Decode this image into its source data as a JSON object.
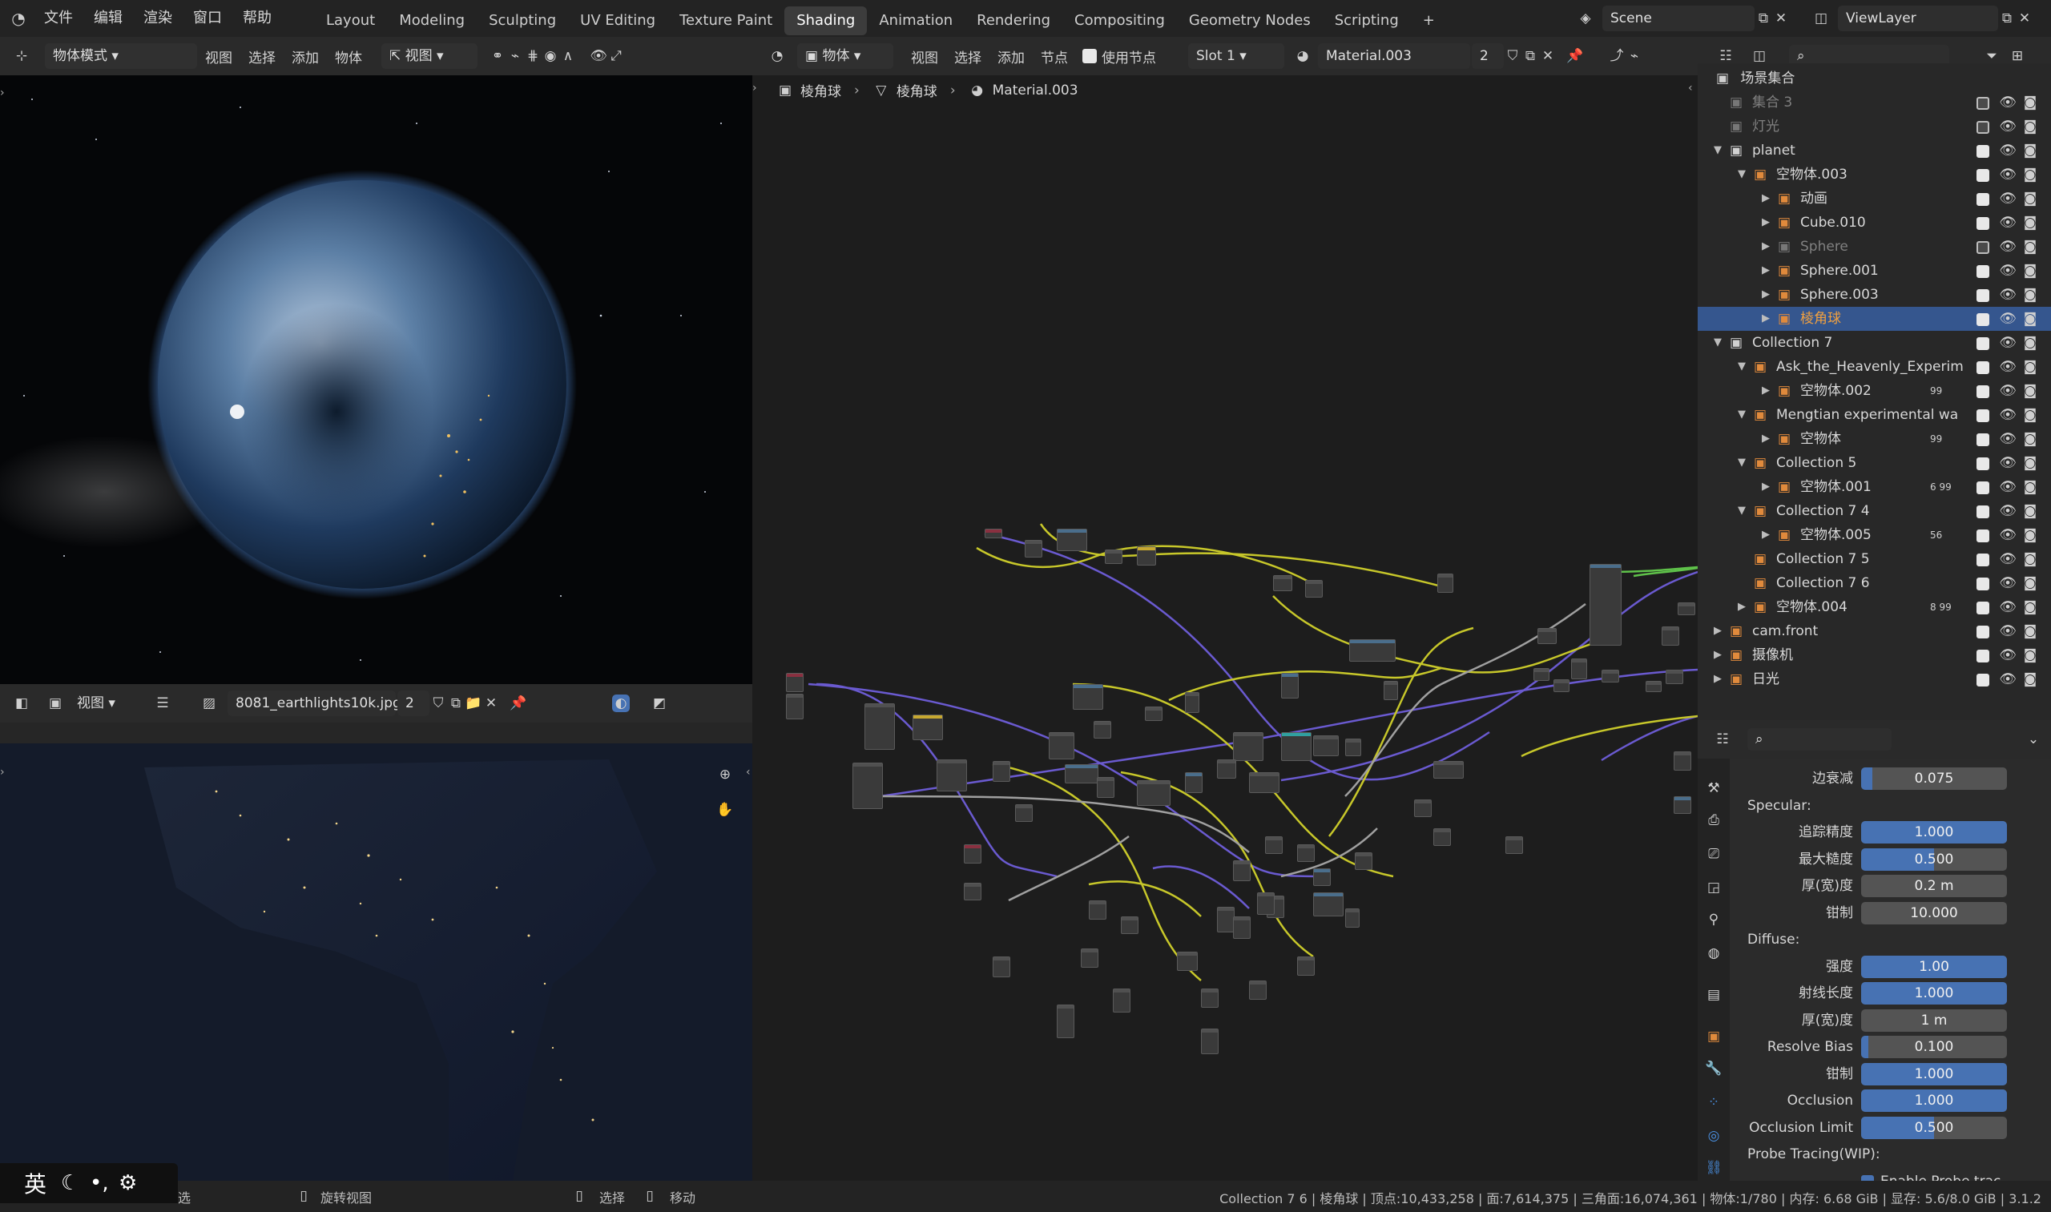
{
  "topbar": {
    "menus": [
      "文件",
      "编辑",
      "渲染",
      "窗口",
      "帮助"
    ],
    "workspaces": [
      "Layout",
      "Modeling",
      "Sculpting",
      "UV Editing",
      "Texture Paint",
      "Shading",
      "Animation",
      "Rendering",
      "Compositing",
      "Geometry Nodes",
      "Scripting"
    ],
    "active_workspace": "Shading",
    "plus": "+",
    "scene": "Scene",
    "view_layer": "ViewLayer"
  },
  "viewport_header": {
    "mode": "物体模式",
    "menus": [
      "视图",
      "选择",
      "添加",
      "物体"
    ],
    "orientation": "视图"
  },
  "node_header": {
    "object_type": "物体",
    "menus": [
      "视图",
      "选择",
      "添加",
      "节点"
    ],
    "use_nodes": "使用节点",
    "slot": "Slot 1",
    "material": "Material.003",
    "users": "2"
  },
  "breadcrumb": [
    "棱角球",
    "棱角球",
    "Material.003"
  ],
  "image_header": {
    "view": "视图",
    "image_name": "8081_earthlights10k.jpg",
    "users": "2"
  },
  "outliner": {
    "title": "场景集合",
    "rows": [
      {
        "label": "集合 3",
        "indent": 0,
        "dim": true,
        "tw": ""
      },
      {
        "label": "灯光",
        "indent": 0,
        "dim": true,
        "tw": ""
      },
      {
        "label": "planet",
        "indent": 0,
        "tw": "▼"
      },
      {
        "label": "空物体.003",
        "indent": 1,
        "tw": "▼"
      },
      {
        "label": "动画",
        "indent": 2,
        "tw": "▶"
      },
      {
        "label": "Cube.010",
        "indent": 2,
        "tw": "▶"
      },
      {
        "label": "Sphere",
        "indent": 2,
        "tw": "▶",
        "dim": true
      },
      {
        "label": "Sphere.001",
        "indent": 2,
        "tw": "▶"
      },
      {
        "label": "Sphere.003",
        "indent": 2,
        "tw": "▶"
      },
      {
        "label": "棱角球",
        "indent": 2,
        "tw": "▶",
        "selected": true
      },
      {
        "label": "Collection 7",
        "indent": 0,
        "tw": "▼"
      },
      {
        "label": "Ask_the_Heavenly_Experim",
        "indent": 1,
        "tw": "▼"
      },
      {
        "label": "空物体.002",
        "indent": 2,
        "tw": "▶",
        "badge": "99"
      },
      {
        "label": "Mengtian experimental wa",
        "indent": 1,
        "tw": "▼"
      },
      {
        "label": "空物体",
        "indent": 2,
        "tw": "▶",
        "badge": "99"
      },
      {
        "label": "Collection 5",
        "indent": 1,
        "tw": "▼"
      },
      {
        "label": "空物体.001",
        "indent": 2,
        "tw": "▶",
        "badge": "6 99"
      },
      {
        "label": "Collection 7 4",
        "indent": 1,
        "tw": "▼"
      },
      {
        "label": "空物体.005",
        "indent": 2,
        "tw": "▶",
        "badge": "56"
      },
      {
        "label": "Collection 7 5",
        "indent": 1,
        "tw": ""
      },
      {
        "label": "Collection 7 6",
        "indent": 1,
        "tw": ""
      },
      {
        "label": "空物体.004",
        "indent": 1,
        "tw": "▶",
        "badge": "8 99"
      },
      {
        "label": "cam.front",
        "indent": 0,
        "tw": "▶"
      },
      {
        "label": "摄像机",
        "indent": 0,
        "tw": "▶"
      },
      {
        "label": "日光",
        "indent": 0,
        "tw": "▶"
      }
    ]
  },
  "properties": {
    "rows": [
      {
        "type": "field",
        "label": "边衰减",
        "value": "0.075",
        "fill": 0.075
      },
      {
        "type": "header",
        "label": "Specular:"
      },
      {
        "type": "field",
        "label": "追踪精度",
        "value": "1.000",
        "fill": 1.0
      },
      {
        "type": "field",
        "label": "最大糙度",
        "value": "0.500",
        "fill": 0.5
      },
      {
        "type": "field",
        "label": "厚(宽)度",
        "value": "0.2 m",
        "fill": 0
      },
      {
        "type": "field",
        "label": "钳制",
        "value": "10.000",
        "fill": 0
      },
      {
        "type": "header",
        "label": "Diffuse:"
      },
      {
        "type": "field",
        "label": "强度",
        "value": "1.00",
        "fill": 1.0
      },
      {
        "type": "field",
        "label": "射线长度",
        "value": "1.000",
        "fill": 1.0
      },
      {
        "type": "field",
        "label": "厚(宽)度",
        "value": "1 m",
        "fill": 0
      },
      {
        "type": "field",
        "label": "Resolve Bias",
        "value": "0.100",
        "fill": 0.05
      },
      {
        "type": "field",
        "label": "钳制",
        "value": "1.000",
        "fill": 1.0
      },
      {
        "type": "field",
        "label": "Occlusion",
        "value": "1.000",
        "fill": 1.0
      },
      {
        "type": "field",
        "label": "Occlusion Limit",
        "value": "0.500",
        "fill": 0.5
      },
      {
        "type": "header",
        "label": "Probe Tracing(WIP):"
      },
      {
        "type": "check",
        "label": "Enable Probe trac..."
      }
    ]
  },
  "status": {
    "ime": "英",
    "left_hint": "选",
    "rotate": "旋转视图",
    "select": "选择",
    "move": "移动",
    "stats": "Collection 7 6 | 棱角球 | 顶点:10,433,258 | 面:7,614,375 | 三角面:16,074,361 | 物体:1/780 | 内存: 6.68 GiB | 显存: 5.6/8.0 GiB | 3.1.2"
  },
  "colors": {
    "selected_row": "#35568e",
    "accent_blue": "#4772b3",
    "wire_yellow": "#c7c72a",
    "wire_purple": "#6a5ad0",
    "wire_gray": "#a0a0a0",
    "wire_green": "#5fc24a"
  }
}
